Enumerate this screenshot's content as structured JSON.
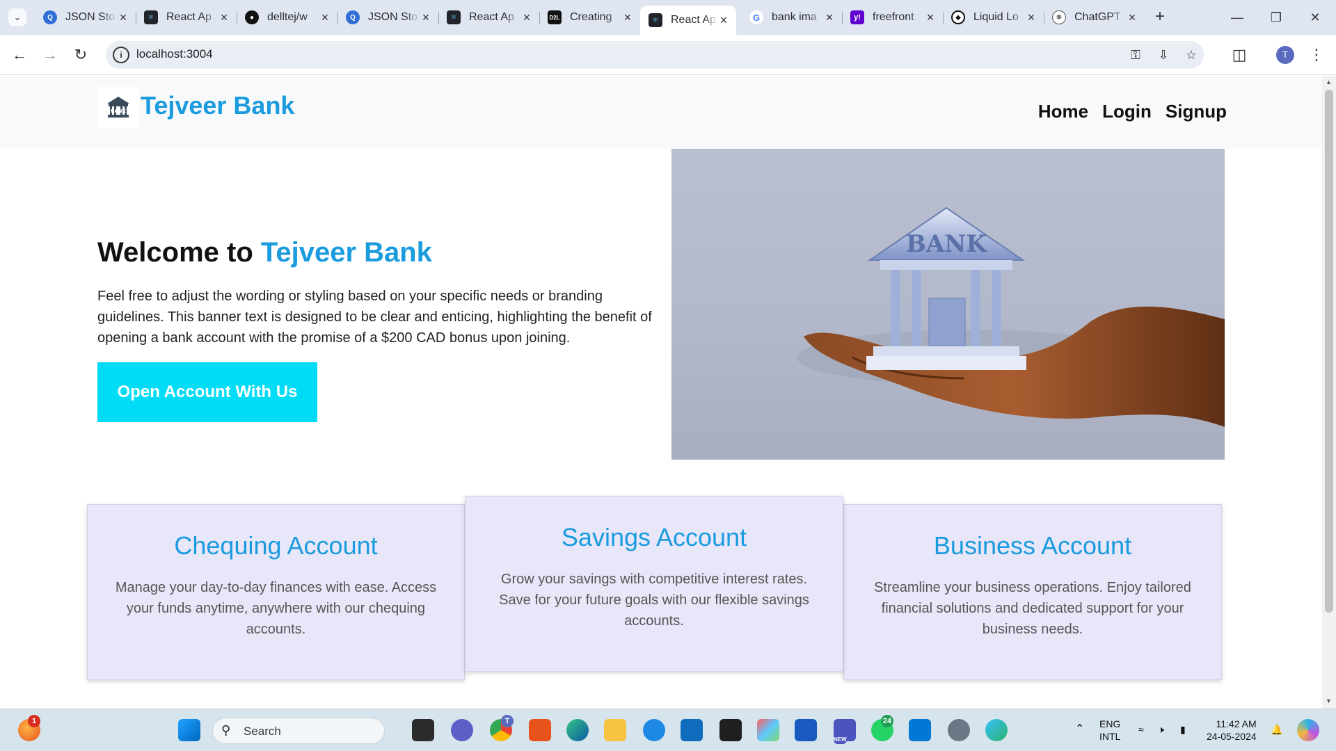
{
  "browser": {
    "tabs": [
      {
        "title": "JSON Sto",
        "favicon": "query-icon"
      },
      {
        "title": "React Ap",
        "favicon": "react-icon"
      },
      {
        "title": "delltej/w",
        "favicon": "github-icon"
      },
      {
        "title": "JSON Sto",
        "favicon": "query-icon"
      },
      {
        "title": "React Ap",
        "favicon": "react-icon"
      },
      {
        "title": "Creating",
        "favicon": "d2l-icon"
      },
      {
        "title": "React Ap",
        "favicon": "react-icon",
        "active": true
      },
      {
        "title": "bank ima",
        "favicon": "google-icon"
      },
      {
        "title": "freefront",
        "favicon": "yahoo-icon"
      },
      {
        "title": "Liquid Lo",
        "favicon": "liquid-icon"
      },
      {
        "title": "ChatGPT",
        "favicon": "chatgpt-icon"
      }
    ],
    "d2l_favicon_text": "D2L",
    "url": "localhost:3004",
    "profile_initial": "T"
  },
  "site": {
    "brand": "Tejveer Bank",
    "logo_text": "BANK",
    "nav": {
      "home": "Home",
      "login": "Login",
      "signup": "Signup"
    },
    "hero": {
      "title_prefix": "Welcome to ",
      "title_accent": "Tejveer Bank",
      "text": "Feel free to adjust the wording or styling based on your specific needs or branding guidelines. This banner text is designed to be clear and enticing, highlighting the benefit of opening a bank account with the promise of a $200 CAD bonus upon joining.",
      "cta": "Open Account With Us",
      "image_label": "BANK"
    },
    "cards": [
      {
        "title": "Chequing Account",
        "text": "Manage your day-to-day finances with ease. Access your funds anytime, anywhere with our chequing accounts."
      },
      {
        "title": "Savings Account",
        "text": "Grow your savings with competitive interest rates. Save for your future goals with our flexible savings accounts."
      },
      {
        "title": "Business Account",
        "text": "Streamline your business operations. Enjoy tailored financial solutions and dedicated support for your business needs."
      }
    ]
  },
  "taskbar": {
    "search_label": "Search",
    "lang_top": "ENG",
    "lang_bottom": "INTL",
    "time": "11:42 AM",
    "date": "24-05-2024",
    "notification_badge": "1",
    "chrome_badge": "T",
    "whatsapp_badge": "24",
    "teams_badge": "NEW"
  },
  "colors": {
    "accent": "#1a9bde",
    "cta": "#00dcf5",
    "card_bg": "#e7e7f9"
  }
}
